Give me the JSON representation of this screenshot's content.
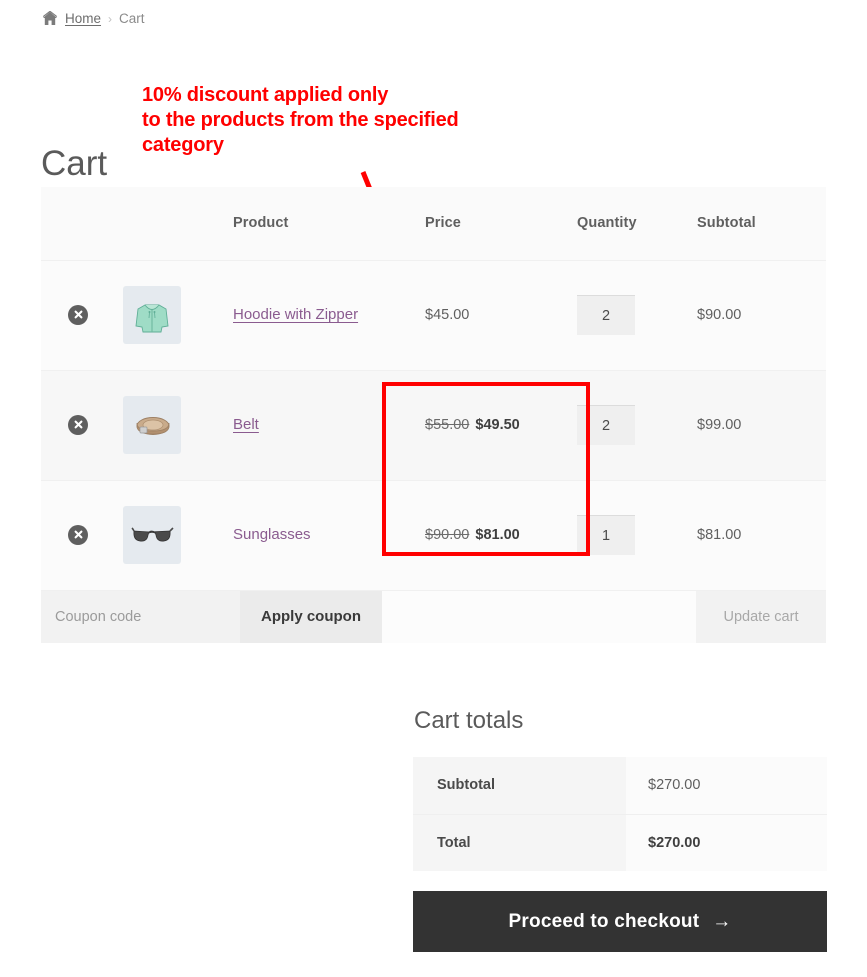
{
  "breadcrumb": {
    "home_icon": "home-icon",
    "home_label": "Home",
    "separator": "›",
    "current": "Cart"
  },
  "page_title": "Cart",
  "annotation": {
    "text": "10% discount applied only\nto the products from the specified\ncategory",
    "color": "#ff0000"
  },
  "table": {
    "headers": {
      "remove": "",
      "thumbnail": "",
      "product": "Product",
      "price": "Price",
      "quantity": "Quantity",
      "subtotal": "Subtotal"
    },
    "rows": [
      {
        "remove_icon": "remove-item-icon",
        "thumb_icon": "hoodie-thumbnail",
        "name": "Hoodie with Zipper",
        "name_is_link": true,
        "price_old": "",
        "price_new": "$45.00",
        "quantity": "2",
        "subtotal": "$90.00",
        "discounted": false
      },
      {
        "remove_icon": "remove-item-icon",
        "thumb_icon": "belt-thumbnail",
        "name": "Belt",
        "name_is_link": true,
        "price_old": "$55.00",
        "price_new": "$49.50",
        "quantity": "2",
        "subtotal": "$99.00",
        "discounted": true
      },
      {
        "remove_icon": "remove-item-icon",
        "thumb_icon": "sunglasses-thumbnail",
        "name": "Sunglasses",
        "name_is_link": false,
        "price_old": "$90.00",
        "price_new": "$81.00",
        "quantity": "1",
        "subtotal": "$81.00",
        "discounted": true
      }
    ]
  },
  "coupon": {
    "placeholder": "Coupon code",
    "value": "",
    "apply_label": "Apply coupon",
    "update_label": "Update cart"
  },
  "totals": {
    "title": "Cart totals",
    "subtotal_label": "Subtotal",
    "subtotal_value": "$270.00",
    "total_label": "Total",
    "total_value": "$270.00"
  },
  "checkout": {
    "label": "Proceed to checkout",
    "arrow": "→"
  }
}
